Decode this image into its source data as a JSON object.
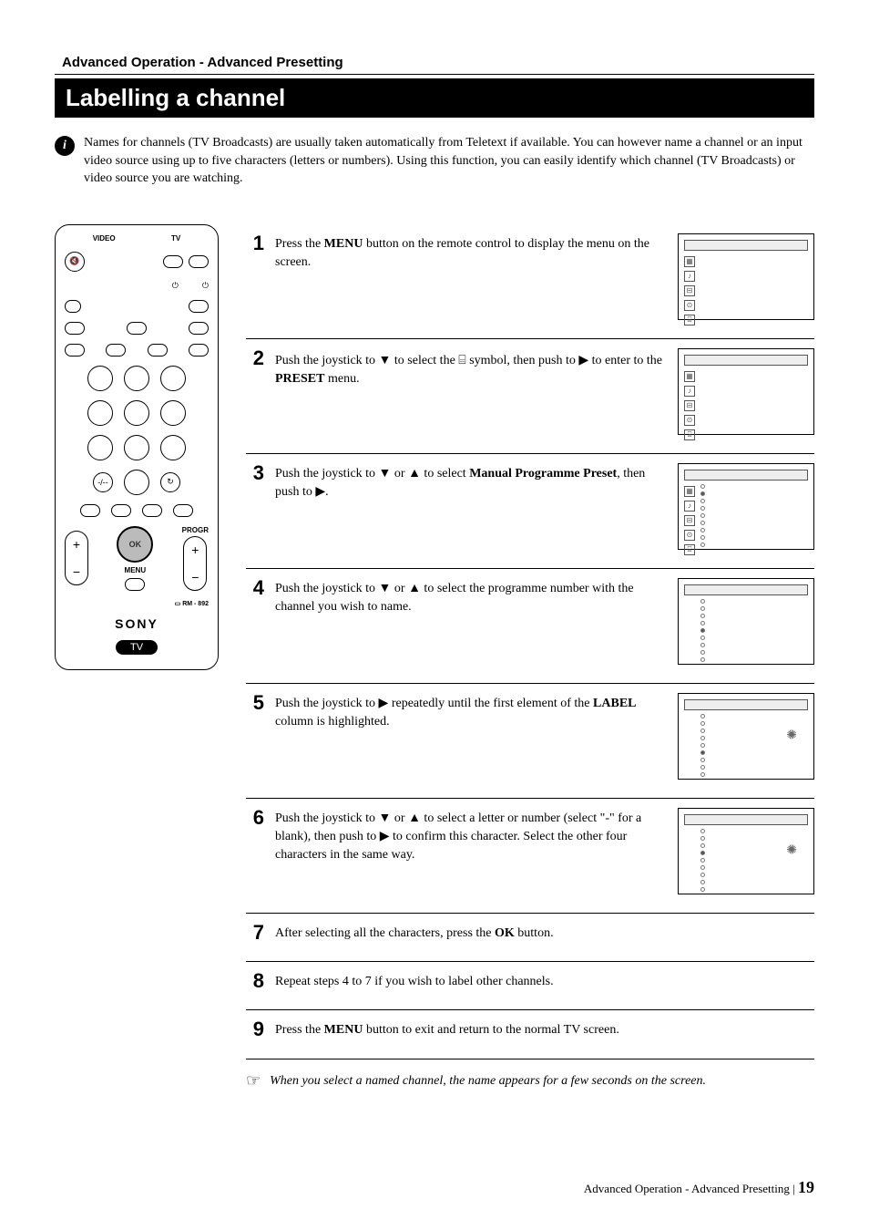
{
  "breadcrumb": "Advanced Operation - Advanced Presetting",
  "title": "Labelling a channel",
  "intro": "Names for channels (TV Broadcasts) are usually taken automatically from Teletext if available. You can however name a channel  or an input video source using up to five characters (letters or numbers). Using this function, you can easily identify which channel (TV Broadcasts) or video source you are watching.",
  "remote": {
    "top_labels": {
      "video": "VIDEO",
      "tv": "TV"
    },
    "power_labels": {
      "left": "⏻",
      "right": "⏻"
    },
    "model": "RM - 892",
    "brand": "SONY",
    "tv_badge": "TV",
    "ok_label": "OK",
    "menu_label": "MENU",
    "progr_label": "PROGR"
  },
  "steps": [
    {
      "num": "1",
      "text_pre": "Press the ",
      "bold1": "MENU",
      "text_mid": " button on the remote control to display the menu on the screen.",
      "has_screen": true
    },
    {
      "num": "2",
      "text_pre": "Push the joystick to ▼ to select the  ",
      "icon": "⌸",
      "text_mid": "  symbol, then push to ▶ to enter to the ",
      "bold1": "PRESET",
      "text_post": " menu.",
      "has_screen": true
    },
    {
      "num": "3",
      "text_pre": "Push the joystick to ▼ or ▲ to select ",
      "bold1": "Manual Programme Preset",
      "text_mid": ", then push to ▶.",
      "has_screen": true,
      "dots": 1
    },
    {
      "num": "4",
      "text_pre": "Push the joystick to ▼ or ▲ to select the programme number with the channel you wish to name.",
      "has_screen": true,
      "dots": 4
    },
    {
      "num": "5",
      "text_pre": "Push the joystick to ▶ repeatedly until the first element of the ",
      "bold1": "LABEL",
      "text_mid": " column is highlighted.",
      "has_screen": true,
      "dots": 5,
      "sun": true
    },
    {
      "num": "6",
      "text_pre": "Push the joystick to ▼ or ▲ to select a letter or number (select \"-\" for a blank), then push to ▶ to confirm this character. Select the other four characters in the same way.",
      "has_screen": true,
      "dots": 3,
      "sun": true
    },
    {
      "num": "7",
      "text_pre": "After selecting all the characters, press the ",
      "bold1": "OK",
      "text_mid": " button.",
      "has_screen": false
    },
    {
      "num": "8",
      "text_pre": "Repeat steps 4 to 7 if you wish to label other channels.",
      "has_screen": false
    },
    {
      "num": "9",
      "text_pre": "Press the ",
      "bold1": "MENU",
      "text_mid": " button to exit and return to the normal TV screen.",
      "has_screen": false
    }
  ],
  "note": "When you select a named channel, the name appears for a few seconds on the screen.",
  "footer": {
    "section": "Advanced Operation - Advanced Presetting",
    "page": "19"
  }
}
